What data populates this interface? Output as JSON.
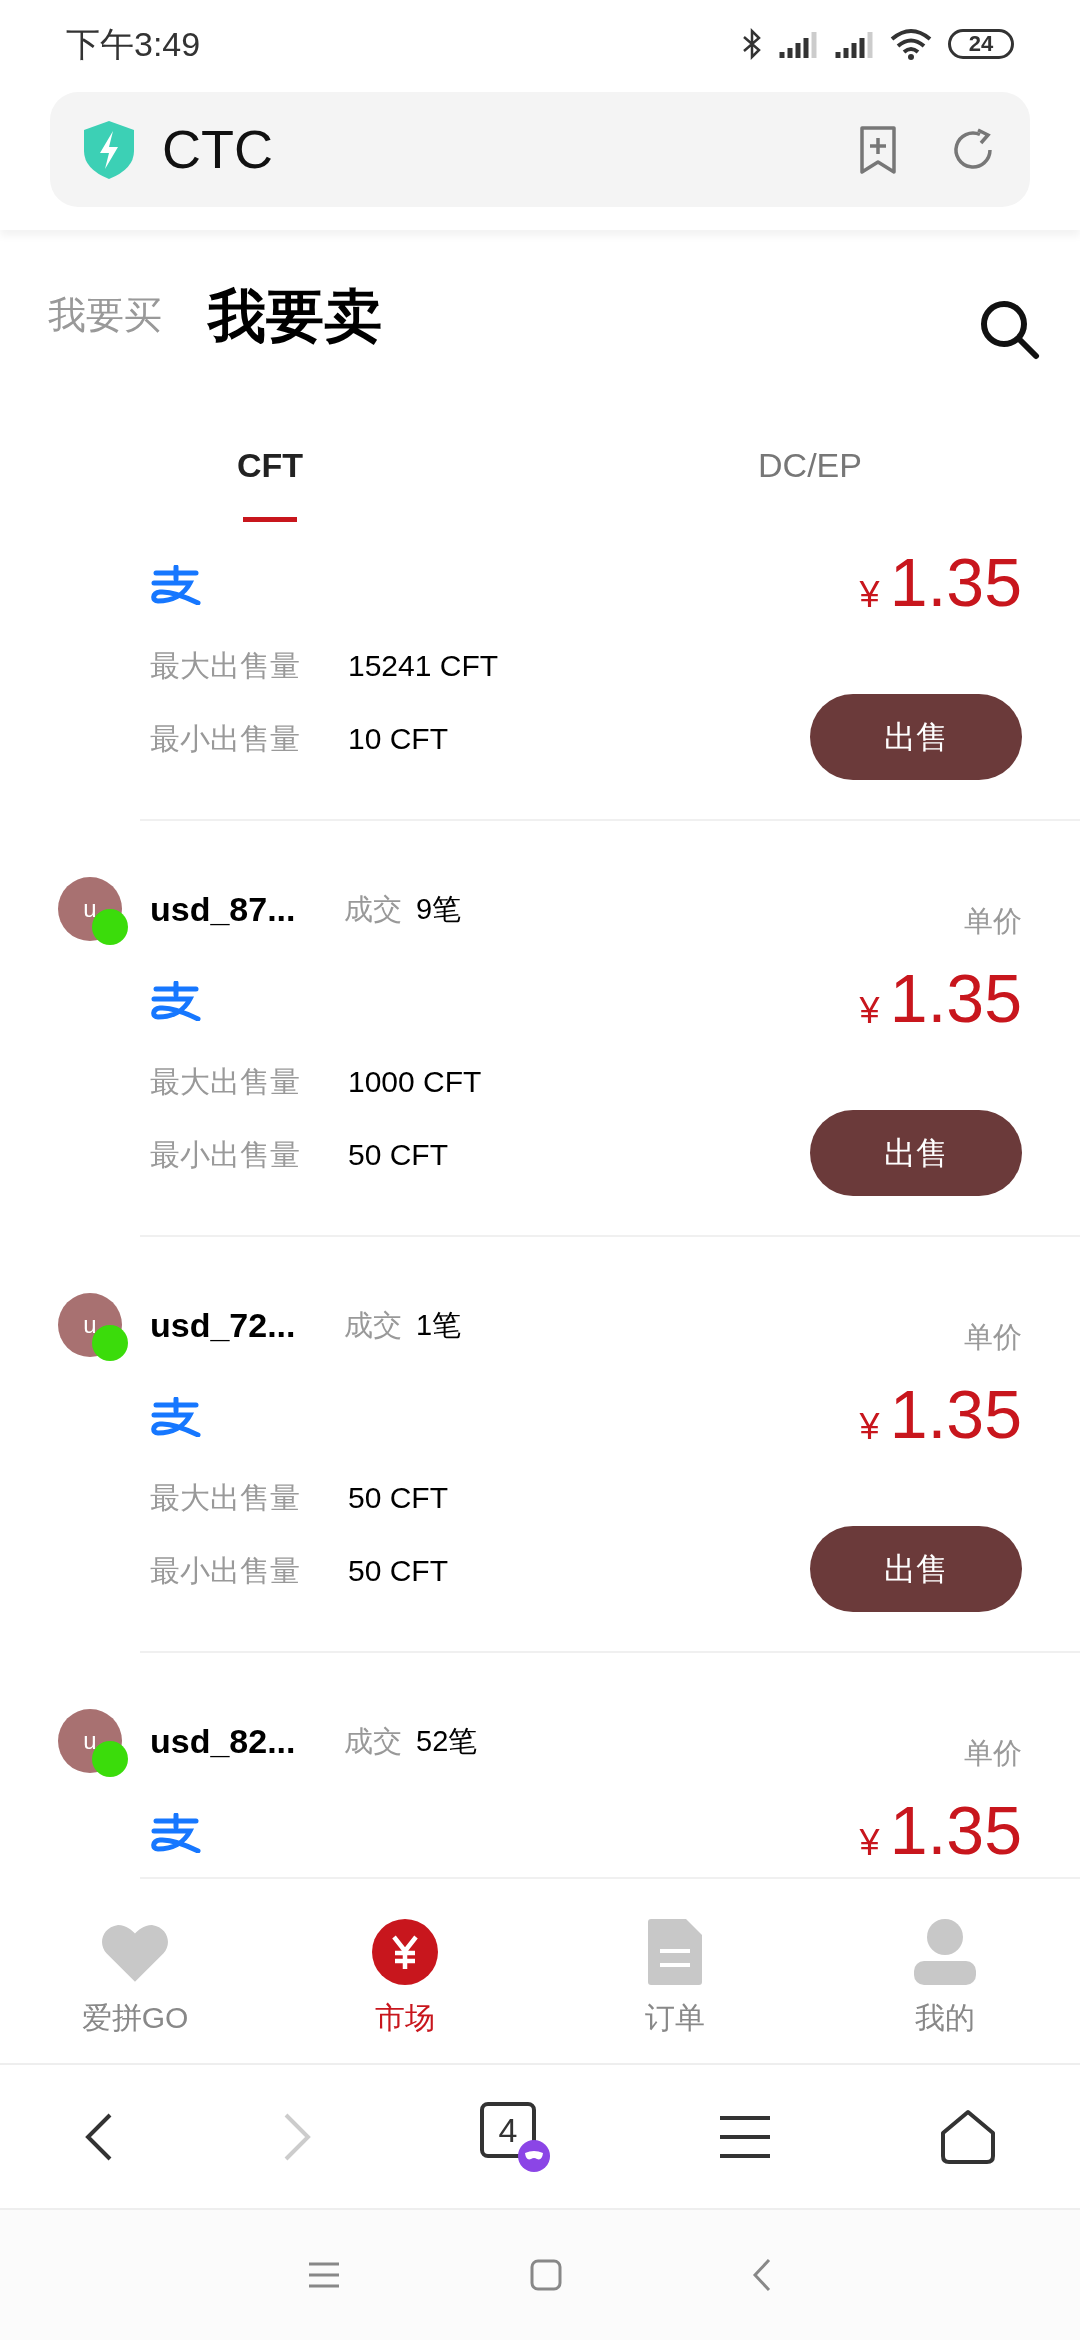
{
  "status_bar": {
    "time": "下午3:49",
    "battery": "24"
  },
  "address_bar": {
    "title": "CTC"
  },
  "trade_tabs": [
    {
      "label": "我要买",
      "selected": false
    },
    {
      "label": "我要卖",
      "selected": true
    }
  ],
  "coin_tabs": [
    {
      "label": "CFT",
      "selected": true
    },
    {
      "label": "DC/EP",
      "selected": false
    }
  ],
  "offers": [
    {
      "payment": {
        "kind": "alipay"
      },
      "currency": "¥",
      "price": "1.35",
      "max_label": "最大出售量",
      "max_value": "15241 CFT",
      "min_label": "最小出售量",
      "min_value": "10 CFT",
      "button": "出售"
    },
    {
      "seller": {
        "avatar": "u",
        "name": "usd_87...",
        "online": true
      },
      "deals_label": "成交",
      "deals": "9笔",
      "unit_label": "单价",
      "payment": {
        "kind": "alipay"
      },
      "currency": "¥",
      "price": "1.35",
      "max_label": "最大出售量",
      "max_value": "1000 CFT",
      "min_label": "最小出售量",
      "min_value": "50 CFT",
      "button": "出售"
    },
    {
      "seller": {
        "avatar": "u",
        "name": "usd_72...",
        "online": true
      },
      "deals_label": "成交",
      "deals": "1笔",
      "unit_label": "单价",
      "payment": {
        "kind": "alipay"
      },
      "currency": "¥",
      "price": "1.35",
      "max_label": "最大出售量",
      "max_value": "50 CFT",
      "min_label": "最小出售量",
      "min_value": "50 CFT",
      "button": "出售"
    },
    {
      "seller": {
        "avatar": "u",
        "name": "usd_82...",
        "online": true
      },
      "deals_label": "成交",
      "deals": "52笔",
      "unit_label": "单价",
      "payment": {
        "kind": "alipay"
      },
      "currency": "¥",
      "price": "1.35"
    }
  ],
  "bottom_nav": [
    {
      "label": "爱拼GO",
      "selected": false
    },
    {
      "label": "市场",
      "selected": true
    },
    {
      "label": "订单",
      "selected": false
    },
    {
      "label": "我的",
      "selected": false
    }
  ],
  "browser_bar": {
    "tab_count": "4"
  }
}
